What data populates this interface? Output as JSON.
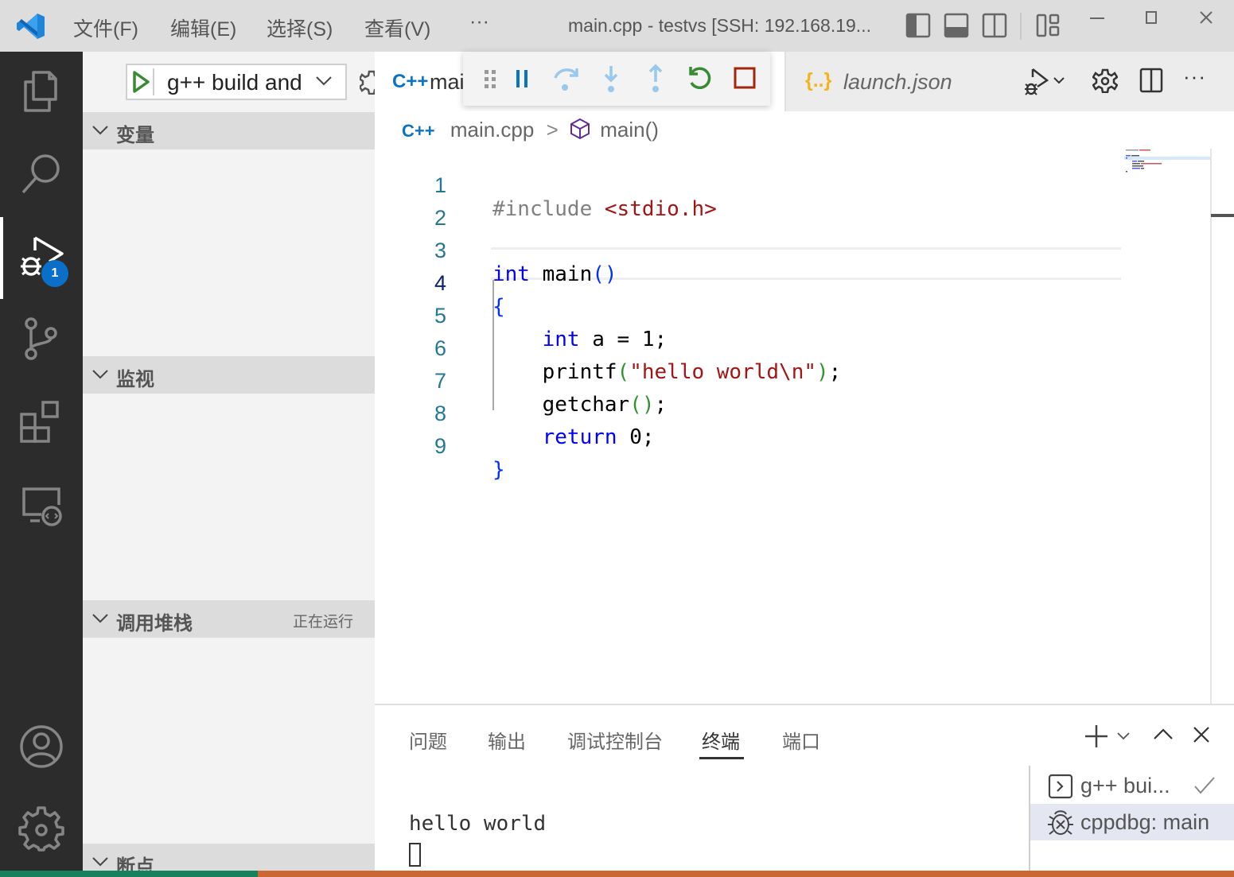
{
  "titlebar": {
    "menus": [
      "文件(F)",
      "编辑(E)",
      "选择(S)",
      "查看(V)",
      "···"
    ],
    "window_title": "main.cpp - testvs [SSH: 192.168.19..."
  },
  "activitybar": {
    "items": [
      {
        "name": "explorer",
        "active": false
      },
      {
        "name": "search",
        "active": false
      },
      {
        "name": "run-and-debug",
        "active": true,
        "badge": "1"
      },
      {
        "name": "source-control",
        "active": false
      },
      {
        "name": "extensions",
        "active": false
      },
      {
        "name": "remote-explorer",
        "active": false
      }
    ],
    "bottom": [
      "accounts",
      "manage"
    ]
  },
  "sidebar": {
    "launch_config": "g++ build and",
    "sections": [
      {
        "title": "变量",
        "status": ""
      },
      {
        "title": "监视",
        "status": ""
      },
      {
        "title": "调用堆栈",
        "status": "正在运行"
      },
      {
        "title": "断点",
        "status": ""
      }
    ]
  },
  "tabs": [
    {
      "icon": "C++",
      "label": "mai",
      "active": true
    },
    {
      "icon": "{..}",
      "label": "launch.json",
      "active": false
    }
  ],
  "debug_toolbar": {
    "buttons": [
      "drag-handle",
      "pause",
      "step-over",
      "step-into",
      "step-out",
      "restart",
      "stop"
    ]
  },
  "editor_actions": [
    "run-debug",
    "settings",
    "split-editor",
    "more"
  ],
  "breadcrumb": {
    "icon": "C++",
    "file": "main.cpp",
    "separator": ">",
    "symbol": "main()"
  },
  "code": {
    "lines": [
      {
        "n": "1",
        "text": "#include <stdio.h>"
      },
      {
        "n": "2",
        "text": ""
      },
      {
        "n": "3",
        "text": "int main()"
      },
      {
        "n": "4",
        "text": "{"
      },
      {
        "n": "5",
        "text": "    int a = 1;"
      },
      {
        "n": "6",
        "text": "    printf(\"hello world\\n\");"
      },
      {
        "n": "7",
        "text": "    getchar();"
      },
      {
        "n": "8",
        "text": "    return 0;"
      },
      {
        "n": "9",
        "text": "}"
      }
    ],
    "current_line": 4
  },
  "panel": {
    "tabs": [
      "问题",
      "输出",
      "调试控制台",
      "终端",
      "端口"
    ],
    "active_tab": "终端",
    "terminal_output": "hello world",
    "terminals": [
      {
        "icon": "terminal",
        "label": "g++ bui...",
        "status": "check"
      },
      {
        "icon": "debug",
        "label": "cppdbg: main",
        "selected": true
      }
    ]
  },
  "colors": {
    "accent": "#0a6fc9",
    "statusbar": "#cc6633",
    "remote_indicator": "#16825d"
  }
}
